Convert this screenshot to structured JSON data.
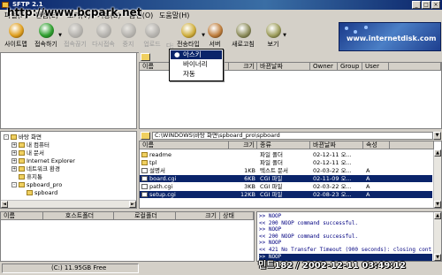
{
  "window": {
    "title": "SFTP 2.1"
  },
  "menu": [
    "파일(F)",
    "편집(E)",
    "보기(V)",
    "기능(B)",
    "옵션(O)",
    "도움말(H)"
  ],
  "toolbar": [
    {
      "label": "사이트맵",
      "icon": "sitemap-icon",
      "enabled": true
    },
    {
      "label": "접속하기",
      "icon": "connect-icon",
      "enabled": true
    },
    {
      "label": "접속끊기",
      "icon": "disconnect-icon",
      "enabled": false
    },
    {
      "label": "다시접속",
      "icon": "reconnect-icon",
      "enabled": false
    },
    {
      "label": "중지",
      "icon": "stop-icon",
      "enabled": false
    },
    {
      "label": "업로드",
      "icon": "upload-icon",
      "enabled": false
    },
    {
      "label": "다운로드",
      "icon": "download-icon",
      "enabled": false
    },
    {
      "label": "전송타입",
      "icon": "transfer-type-icon",
      "enabled": true
    },
    {
      "label": "서버",
      "icon": "server-icon",
      "enabled": true
    },
    {
      "label": "새로고침",
      "icon": "refresh-icon",
      "enabled": true
    },
    {
      "label": "보기",
      "icon": "view-icon",
      "enabled": true
    }
  ],
  "banner": {
    "text": "www.internetdisk.com"
  },
  "watermark": "http://www.bcpark.net",
  "transfer_type_menu": [
    {
      "label": "아스키",
      "checked": true
    },
    {
      "label": "바이너리",
      "checked": false
    },
    {
      "label": "자동",
      "checked": false
    }
  ],
  "remote": {
    "columns": [
      "이름",
      "크기",
      "바뀐날짜",
      "Owner",
      "Group",
      "User"
    ]
  },
  "local_tree": [
    {
      "label": "바탕 화면",
      "indent": 0,
      "expander": "-"
    },
    {
      "label": "내 컴퓨터",
      "indent": 1,
      "expander": "+"
    },
    {
      "label": "내 문서",
      "indent": 1,
      "expander": "+"
    },
    {
      "label": "Internet Explorer",
      "indent": 1,
      "expander": "+"
    },
    {
      "label": "네트워크 환경",
      "indent": 1,
      "expander": "+"
    },
    {
      "label": "휴지통",
      "indent": 1,
      "expander": ""
    },
    {
      "label": "spboard_pro",
      "indent": 1,
      "expander": "-"
    },
    {
      "label": "spboard",
      "indent": 2,
      "expander": ""
    }
  ],
  "local": {
    "path": "C:\\WINDOWS\\바탕 화면\\spboard_pro\\spboard",
    "columns": [
      "이름",
      "크기",
      "종류",
      "바뀐날짜",
      "속성"
    ],
    "files": [
      {
        "name": "readme",
        "size": "",
        "type": "파일 폴더",
        "date": "02-12-11 오...",
        "attr": "",
        "kind": "folder",
        "selected": false
      },
      {
        "name": "tpl",
        "size": "",
        "type": "파일 폴더",
        "date": "02-12-11 오...",
        "attr": "",
        "kind": "folder",
        "selected": false
      },
      {
        "name": "설명서",
        "size": "1KB",
        "type": "텍스트 문서",
        "date": "02-03-22 오...",
        "attr": "A",
        "kind": "file",
        "selected": false
      },
      {
        "name": "board.cgi",
        "size": "6KB",
        "type": "CGI 파일",
        "date": "02-11-09 오...",
        "attr": "A",
        "kind": "file",
        "selected": true
      },
      {
        "name": "path.cgi",
        "size": "3KB",
        "type": "CGI 파일",
        "date": "02-03-22 오...",
        "attr": "A",
        "kind": "file",
        "selected": false
      },
      {
        "name": "setup.cgi",
        "size": "12KB",
        "type": "CGI 파일",
        "date": "02-08-23 오...",
        "attr": "A",
        "kind": "file",
        "selected": true
      }
    ]
  },
  "queue": {
    "columns": [
      "이름",
      "호스트폴더",
      "로컬폴더",
      "크기",
      "상태"
    ]
  },
  "log": [
    ">> NOOP",
    "<< 200 NOOP command successful.",
    ">> NOOP",
    "<< 200 NOOP command successful.",
    ">> NOOP",
    "<< 421 No Transfer Timeout (900 seconds): closing contro",
    ">> NOOP"
  ],
  "status": {
    "free_space": "(C:) 11.95GB Free"
  },
  "timestamp": "민트182 / 2002-12-11 03:49:12",
  "colors": {
    "selection": "#0a246a",
    "title_bar": "#0a246a",
    "log_text": "#000080",
    "chrome": "#d4d0c8"
  }
}
